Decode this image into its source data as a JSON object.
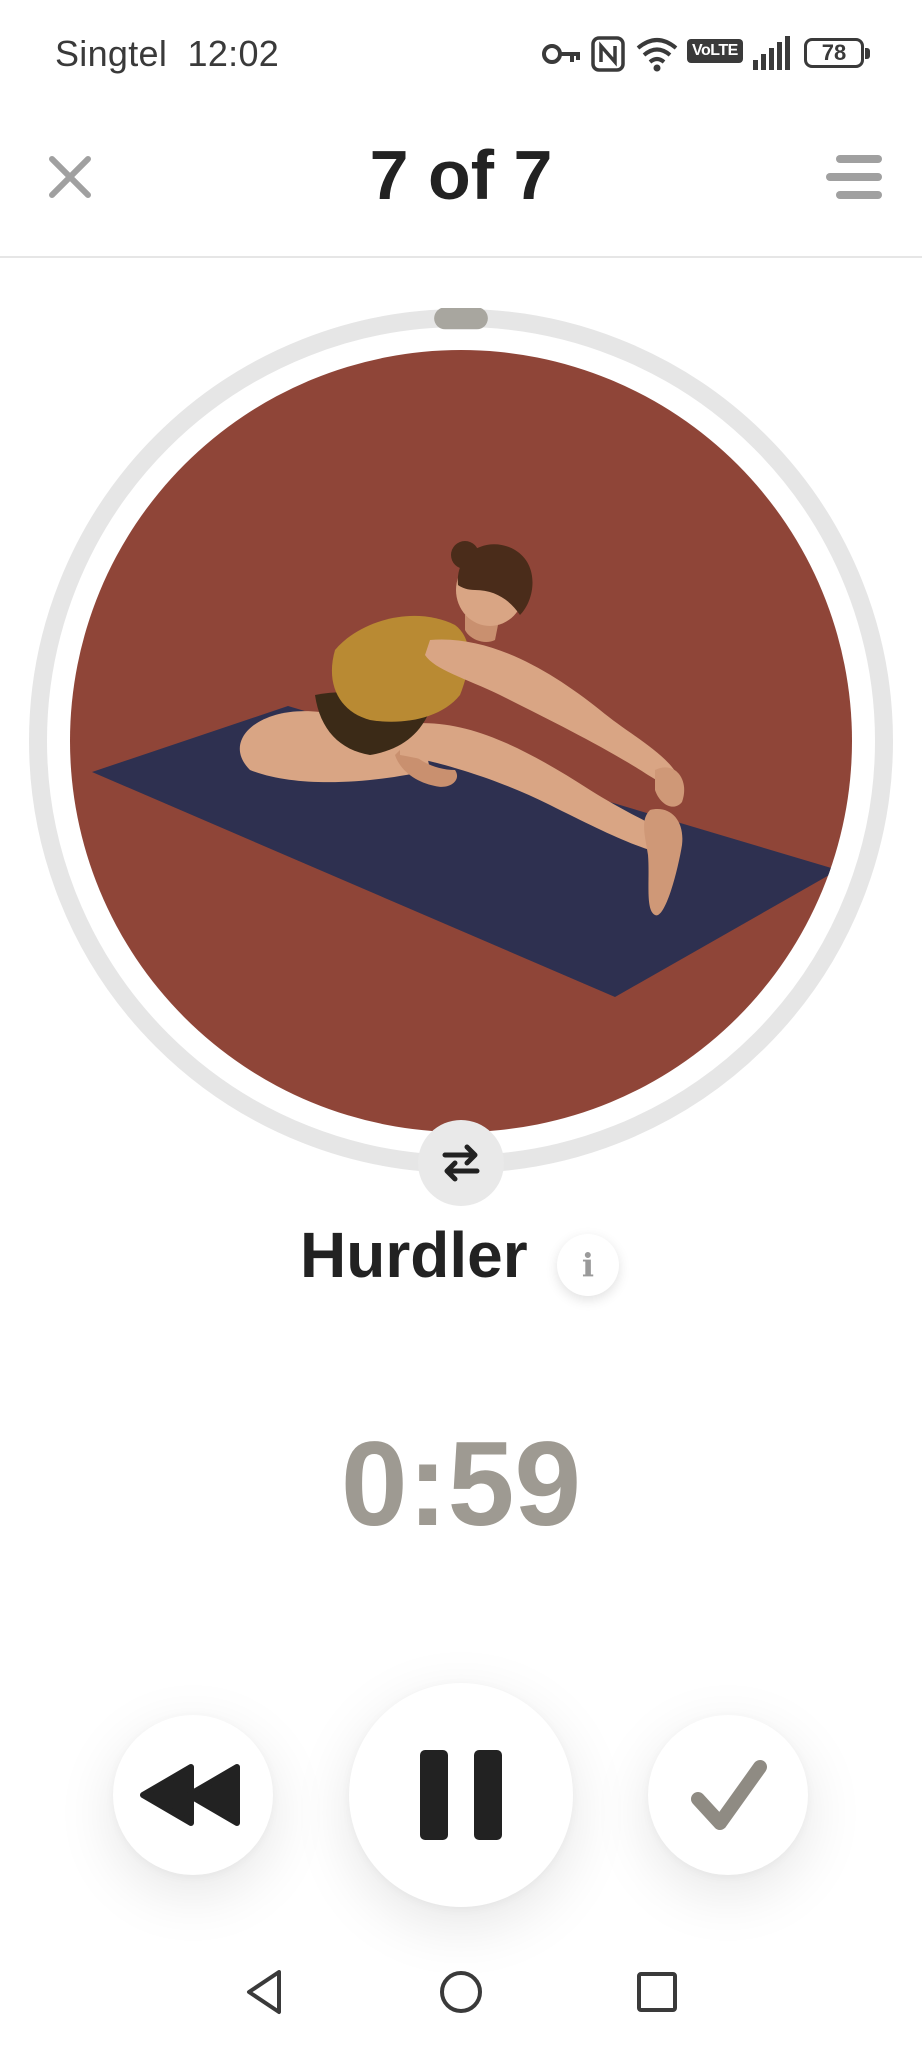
{
  "status_bar": {
    "carrier": "Singtel",
    "time": "12:02",
    "network_badge": "VoLTE",
    "battery_level": "78",
    "icons": [
      "vpn-key-icon",
      "nfc-icon",
      "wifi-icon",
      "volte-icon",
      "signal-icon",
      "battery-icon"
    ]
  },
  "header": {
    "title": "7 of 7",
    "close_icon": "close-icon",
    "menu_icon": "menu-icon"
  },
  "exercise": {
    "name": "Hurdler",
    "info_label": "i",
    "timer": "0:59",
    "progress_fraction": 0.0,
    "illustration": "seated hurdler stretch on yoga mat",
    "colors": {
      "background": "#8f4538",
      "mat": "#2e3050",
      "skin": "#d9a584",
      "top": "#b98a33",
      "shorts": "#3b2a17",
      "hair": "#4a2c1a",
      "ring": "#e6e6e6",
      "ring_handle": "#a8a69f"
    }
  },
  "controls": {
    "rewind_icon": "rewind-icon",
    "pause_icon": "pause-icon",
    "done_icon": "checkmark-icon",
    "swap_icon": "swap-sides-icon"
  },
  "colors": {
    "text_primary": "#222222",
    "timer_text": "#9e9a92",
    "icon_muted": "#a0a0a0",
    "done_check": "#8f8b83"
  },
  "nav_bar": {
    "icons": [
      "back-triangle-icon",
      "home-circle-icon",
      "recents-square-icon"
    ]
  }
}
